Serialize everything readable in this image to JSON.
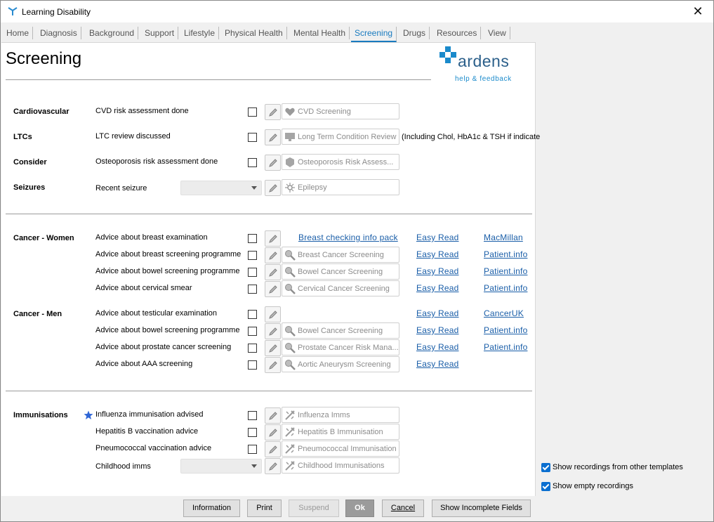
{
  "window": {
    "title": "Learning Disability",
    "close": "✕"
  },
  "tabs": [
    "Home",
    "Diagnosis",
    "Background",
    "Support",
    "Lifestyle",
    "Physical Health",
    "Mental Health",
    "Screening",
    "Drugs",
    "Resources",
    "View"
  ],
  "active_tab": "Screening",
  "page": {
    "title": "Screening"
  },
  "logo": {
    "word": "ardens",
    "sub": "help & feedback",
    "colors": {
      "brand": "#2b5f8a",
      "accent": "#1a8acb"
    }
  },
  "sections": {
    "cardiovascular": "Cardiovascular",
    "ltcs": "LTCs",
    "consider": "Consider",
    "seizures": "Seizures",
    "cancer_women": "Cancer - Women",
    "cancer_men": "Cancer - Men",
    "immunisations": "Immunisations"
  },
  "rows": {
    "cvd": {
      "label": "CVD risk assessment done",
      "code": "CVD Screening",
      "icon": "heart-icon"
    },
    "ltc": {
      "label": "LTC review discussed",
      "code": "Long Term Condition Review",
      "icon": "monitor-icon",
      "note": "(Including Chol, HbA1c & TSH if indicate"
    },
    "osteo": {
      "label": "Osteoporosis risk assessment done",
      "code": "Osteoporosis Risk Assess...",
      "icon": "bone-icon"
    },
    "seizure": {
      "label": "Recent seizure",
      "code": "Epilepsy",
      "icon": "neuron-icon"
    },
    "breast_exam": {
      "label": "Advice about breast examination",
      "link1": "Breast checking info pack",
      "link2": "Easy Read",
      "link3": "MacMillan"
    },
    "breast_screen": {
      "label": "Advice about breast screening programme",
      "code": "Breast Cancer Screening",
      "link2": "Easy Read",
      "link3": "Patient.info"
    },
    "bowel_screen_w": {
      "label": "Advice about bowel screening programme",
      "code": "Bowel Cancer Screening",
      "link2": "Easy Read",
      "link3": "Patient.info"
    },
    "cervical": {
      "label": "Advice about cervical smear",
      "code": "Cervical Cancer Screening",
      "link2": "Easy Read",
      "link3": "Patient.info"
    },
    "testicular": {
      "label": "Advice about testicular examination",
      "link2": "Easy Read",
      "link3": "CancerUK"
    },
    "bowel_screen_m": {
      "label": "Advice about bowel screening programme",
      "code": "Bowel Cancer Screening",
      "link2": "Easy Read",
      "link3": "Patient.info"
    },
    "prostate": {
      "label": "Advice about prostate cancer screening",
      "code": "Prostate Cancer Risk Mana...",
      "link2": "Easy Read",
      "link3": "Patient.info"
    },
    "aaa": {
      "label": "Advice about AAA screening",
      "code": "Aortic Aneurysm Screening",
      "link2": "Easy Read"
    },
    "flu": {
      "label": "Influenza immunisation advised",
      "code": "Influenza Imms"
    },
    "hepb": {
      "label": "Hepatitis B vaccination advice",
      "code": "Hepatitis B Immunisation"
    },
    "pneumo": {
      "label": "Pneumococcal vaccination advice",
      "code": "Pneumococcal Immunisation"
    },
    "child": {
      "label": "Childhood imms",
      "code": "Childhood Immunisations"
    }
  },
  "options": {
    "other_templates": "Show recordings from other templates",
    "empty": "Show empty recordings"
  },
  "buttons": {
    "information": "Information",
    "print": "Print",
    "suspend": "Suspend",
    "ok": "Ok",
    "cancel": "Cancel",
    "incomplete": "Show Incomplete Fields"
  }
}
